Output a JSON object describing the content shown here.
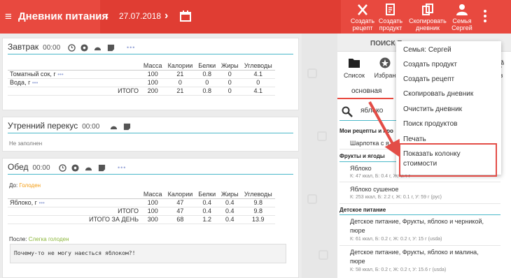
{
  "header": {
    "title": "Дневник питания",
    "date": "27.07.2018",
    "buttons": [
      {
        "label1": "Создать",
        "label2": "рецепт",
        "icon": "fork-knife-icon"
      },
      {
        "label1": "Создать",
        "label2": "продукт",
        "icon": "document-edit-icon"
      },
      {
        "label1": "Скопировать",
        "label2": "дневник",
        "icon": "copy-icon"
      },
      {
        "label1": "Семья",
        "label2": "Сергей",
        "icon": "family-icon"
      }
    ],
    "accent": "#e8493f"
  },
  "breakfast": {
    "title": "Завтрак",
    "time": "00:00",
    "dots": "•••",
    "columns": [
      "Масса",
      "Калории",
      "Белки",
      "Жиры",
      "Углеводы"
    ],
    "rows": [
      {
        "name": "Томатный сок, г",
        "dots": "•••",
        "values": [
          "100",
          "21",
          "0.8",
          "0",
          "4.1"
        ]
      },
      {
        "name": "Вода, г",
        "dots": "•••",
        "values": [
          "100",
          "0",
          "0",
          "0",
          "0"
        ]
      }
    ],
    "total": {
      "label": "ИТОГО",
      "values": [
        "200",
        "21",
        "0.8",
        "0",
        "4.1"
      ]
    }
  },
  "snack": {
    "title": "Утренний перекус",
    "time": "00:00",
    "empty_text": "Не заполнен"
  },
  "lunch": {
    "title": "Обед",
    "time": "00:00",
    "dots": "•••",
    "before_label": "До:",
    "before_value": "Голоден",
    "columns": [
      "Масса",
      "Калории",
      "Белки",
      "Жиры",
      "Углеводы"
    ],
    "rows": [
      {
        "name": "Яблоко, г",
        "dots": "•••",
        "values": [
          "100",
          "47",
          "0.4",
          "0.4",
          "9.8"
        ]
      }
    ],
    "total": {
      "label": "ИТОГО",
      "values": [
        "100",
        "47",
        "0.4",
        "0.4",
        "9.8"
      ]
    },
    "day_total": {
      "label": "ИТОГО ЗА ДЕНЬ",
      "values": [
        "300",
        "68",
        "1.2",
        "0.4",
        "13.9"
      ]
    },
    "after_label": "После:",
    "after_value": "Слегка голоден",
    "note": "Почему-то не могу наесться яблоком?!"
  },
  "right_panel": {
    "tab_title": "ПОИСК П",
    "tabs": [
      {
        "label": "Список",
        "icon": "folder-icon"
      },
      {
        "label": "Избран",
        "icon": "star-icon"
      },
      {
        "label": "лиз",
        "icon": "scale-icon"
      }
    ],
    "subtab": "основная",
    "search_value": "яблоко",
    "sections": [
      {
        "title": "Мои рецепты и про",
        "items": [
          {
            "name": "Шарлотка с я",
            "sub": ""
          }
        ]
      },
      {
        "title": "Фрукты и ягоды",
        "items": [
          {
            "name": "Яблоко",
            "sub": "К: 47 ккал, Б: 0.4 г, Ж: 0.4 г"
          },
          {
            "name": "Яблоко сушеное",
            "sub": "К: 253 ккал, Б: 2.2 г, Ж: 0.1 г, У: 59 г (рус)"
          }
        ]
      },
      {
        "title": "Детское питание",
        "items": [
          {
            "name": "Детское питание, Фрукты, яблоко и черникой,",
            "name2": "пюре",
            "sub": "К: 61 ккал, Б: 0.2 г, Ж: 0.2 г, У: 15 г (usda)"
          },
          {
            "name": "Детское питание, Фрукты, яблоко и малина,",
            "name2": "пюре",
            "sub": "К: 58 ккал, Б: 0.2 г, Ж: 0.2 г, У: 15.6 г (usda)"
          }
        ]
      }
    ]
  },
  "menu": {
    "items": [
      "Семья: Сергей",
      "Создать продукт",
      "Создать рецепт",
      "Скопировать дневник",
      "Очистить дневник",
      "Поиск продуктов",
      "Печать"
    ],
    "highlighted_line1": "Показать колонку",
    "highlighted_line2": "стоимости",
    "highlight_color": "#e34d47"
  }
}
